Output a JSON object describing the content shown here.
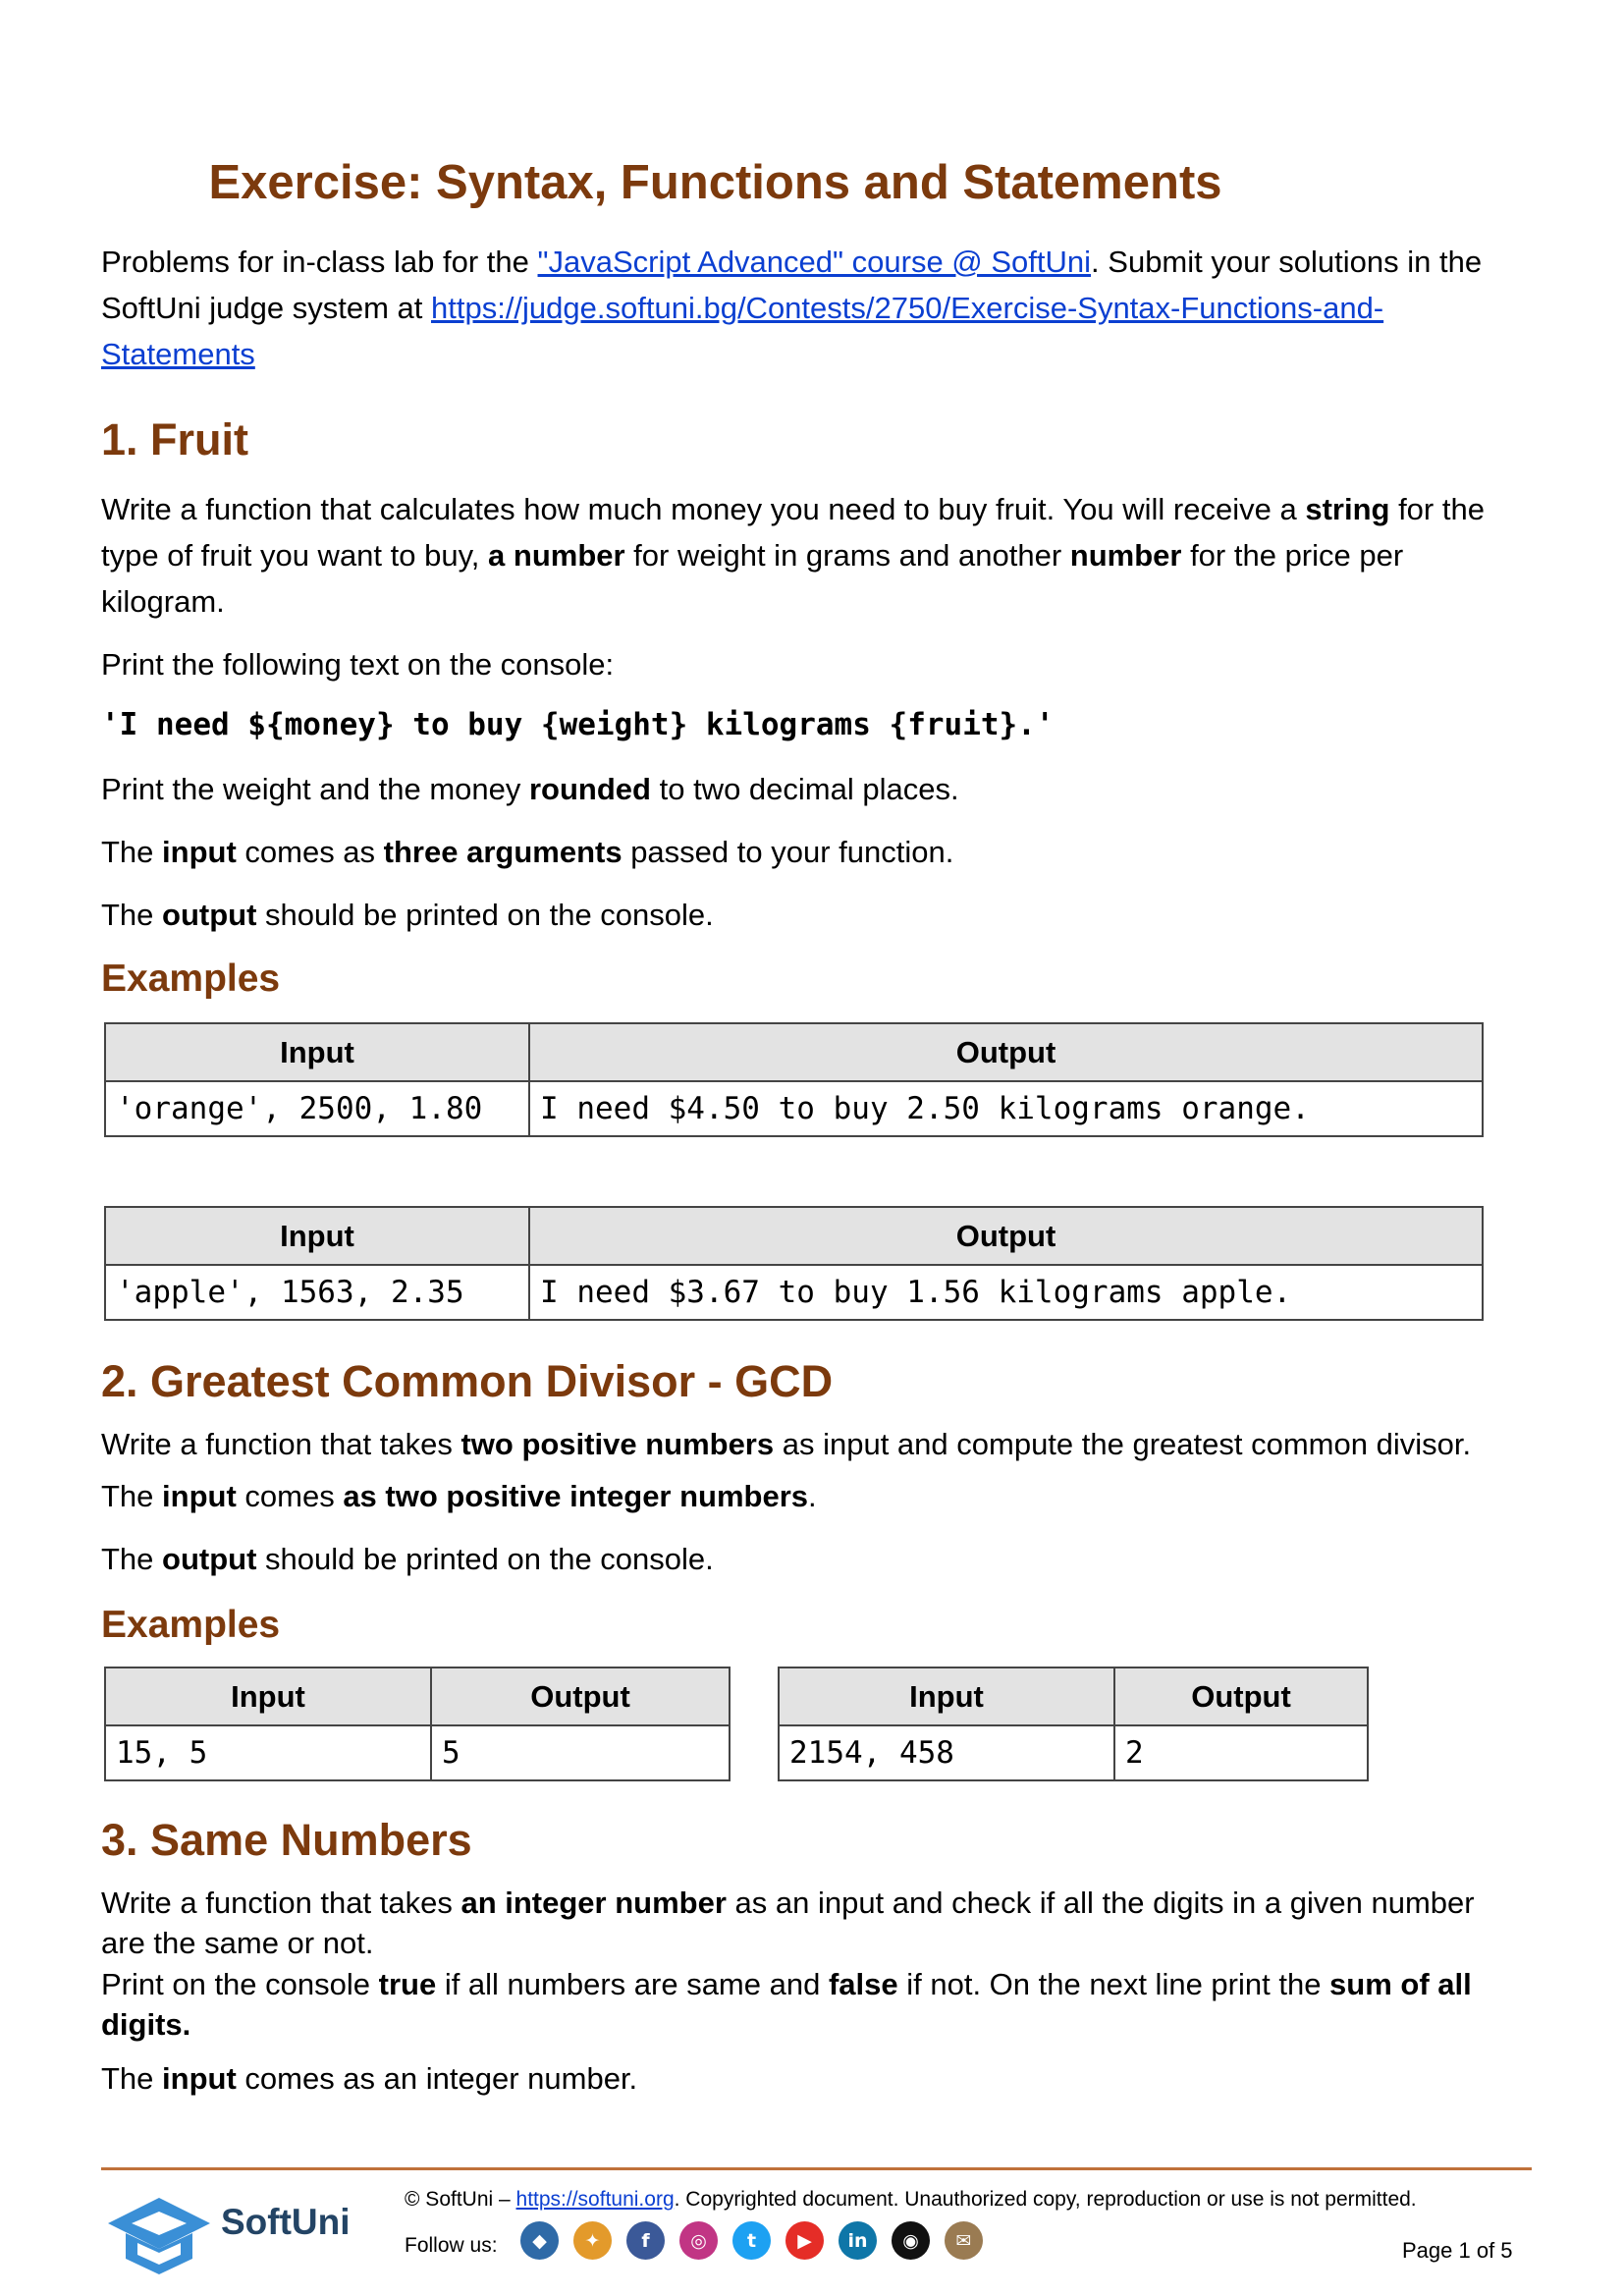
{
  "title": "Exercise: Syntax, Functions and Statements",
  "intro": {
    "prefix": "Problems for in-class lab for the ",
    "course_link": "\"JavaScript Advanced\" course @ SoftUni",
    "middle": ". Submit your solutions in the SoftUni judge system at ",
    "judge_link": "https://judge.softuni.bg/Contests/2750/Exercise-Syntax-Functions-and-Statements"
  },
  "section1": {
    "heading": "1.  Fruit",
    "p1": {
      "a": "Write a function that calculates how much money you need to buy fruit. You will receive a ",
      "b1": "string",
      "c": " for the type of fruit you want to buy, ",
      "b2": "a number",
      "d": " for weight in grams and another ",
      "b3": "number",
      "e": " for the price per kilogram."
    },
    "p2": "Print the following text on the console:",
    "code": "'I need ${money} to buy {weight} kilograms {fruit}.'",
    "p3": {
      "a": "Print the weight and the money ",
      "b": "rounded",
      "c": " to two decimal places."
    },
    "p4": {
      "a": "The ",
      "b1": "input",
      "c": " comes as ",
      "b2": "three arguments",
      "d": " passed to your function."
    },
    "p5": {
      "a": "The ",
      "b": "output",
      "c": " should be printed on the console."
    },
    "examples_heading": "Examples",
    "table1": {
      "input_header": "Input",
      "output_header": "Output",
      "input": "'orange', 2500, 1.80",
      "output": "I need $4.50 to buy 2.50 kilograms orange."
    },
    "table2": {
      "input_header": "Input",
      "output_header": "Output",
      "input": "'apple', 1563, 2.35",
      "output": "I need $3.67 to buy 1.56 kilograms apple."
    }
  },
  "section2": {
    "heading": "2.  Greatest Common Divisor - GCD",
    "p1": {
      "a": "Write a function that takes ",
      "b": "two positive numbers",
      "c": " as input and compute the greatest common divisor."
    },
    "p2": {
      "a": "The ",
      "b1": "input",
      "c": " comes ",
      "b2": "as two positive integer numbers",
      "d": "."
    },
    "p3": {
      "a": "The ",
      "b": "output",
      "c": " should be printed on the console."
    },
    "examples_heading": "Examples",
    "table1": {
      "input_header": "Input",
      "output_header": "Output",
      "input": "15, 5",
      "output": "5"
    },
    "table2": {
      "input_header": "Input",
      "output_header": "Output",
      "input": "2154, 458",
      "output": "2"
    }
  },
  "section3": {
    "heading": "3.  Same Numbers",
    "p1": {
      "a": "Write a function that takes ",
      "b": "an integer number",
      "c": " as an input and check if all the digits in a given number are the same or not."
    },
    "p2": {
      "a": "Print on the console ",
      "b1": "true",
      "c": " if all numbers are same and ",
      "b2": "false",
      "d": " if not. On the next line print the ",
      "b3": "sum of all digits."
    },
    "p3": {
      "a": "The ",
      "b": "input",
      "c": " comes as an integer number."
    }
  },
  "footer": {
    "copyright_prefix": "© SoftUni – ",
    "copyright_link": "https://softuni.org",
    "copyright_suffix": ". Copyrighted document. Unauthorized copy, reproduction or use is not permitted.",
    "follow_label": "Follow us:",
    "brand": "SoftUni",
    "page_number": "Page 1 of 5",
    "icons": [
      {
        "name": "softuni-icon",
        "glyph": "◆",
        "color": "#2f6aa7"
      },
      {
        "name": "softuni-creative-icon",
        "glyph": "✦",
        "color": "#e39a2b"
      },
      {
        "name": "facebook-icon",
        "glyph": "f",
        "color": "#3b5998"
      },
      {
        "name": "instagram-icon",
        "glyph": "◎",
        "color": "#c13584"
      },
      {
        "name": "twitter-icon",
        "glyph": "t",
        "color": "#1da1f2"
      },
      {
        "name": "youtube-icon",
        "glyph": "▶",
        "color": "#e52d27"
      },
      {
        "name": "linkedin-icon",
        "glyph": "in",
        "color": "#0e76a8"
      },
      {
        "name": "github-icon",
        "glyph": "◉",
        "color": "#111111"
      },
      {
        "name": "softuni-mail-icon",
        "glyph": "✉",
        "color": "#9a7b52"
      }
    ]
  }
}
